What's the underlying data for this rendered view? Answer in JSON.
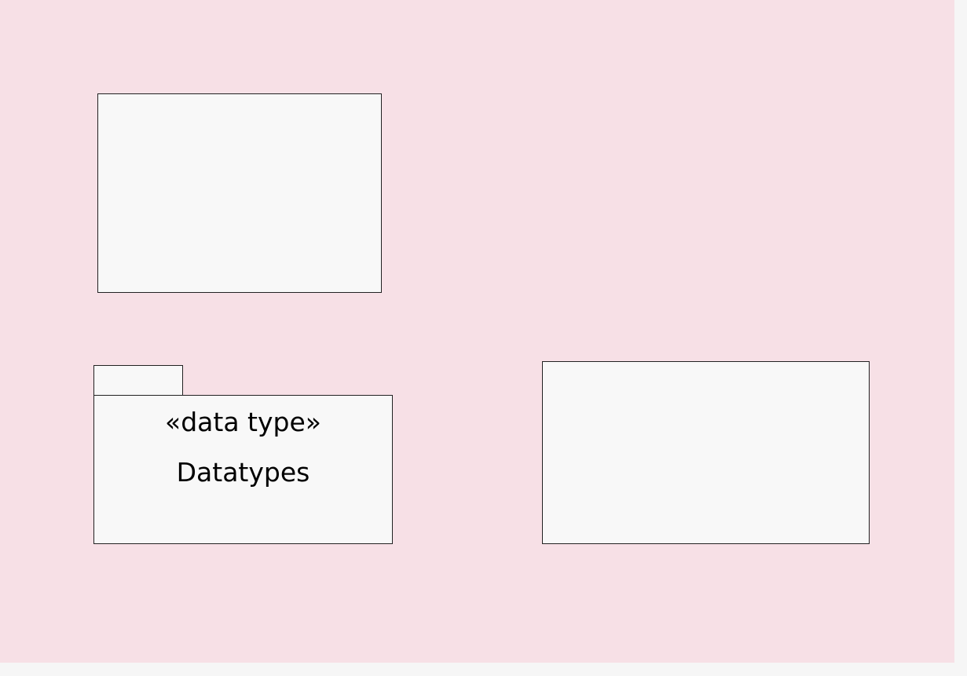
{
  "diagram": {
    "package": {
      "stereotype": "«data type»",
      "name": "Datatypes"
    }
  },
  "colors": {
    "canvas_background": "#f7e0e6",
    "element_fill": "#f8f8f8",
    "border": "#222222",
    "outer_background": "#f6f6f6"
  }
}
